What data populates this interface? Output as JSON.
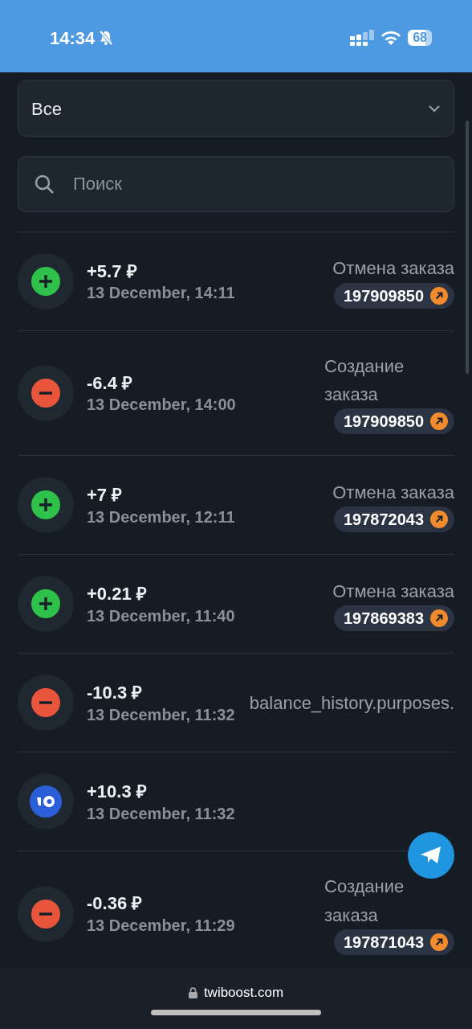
{
  "status_bar": {
    "time": "14:34",
    "battery": "68"
  },
  "filter": {
    "value": "Все"
  },
  "search": {
    "placeholder": "Поиск"
  },
  "transactions": [
    {
      "kind": "plus",
      "amount": "+5.7 ₽",
      "date": "13 December, 14:11",
      "purpose": "Отмена заказа",
      "order": "197909850"
    },
    {
      "kind": "minus",
      "amount": "-6.4 ₽",
      "date": "13 December, 14:00",
      "purpose": "Создание заказа",
      "order": "197909850"
    },
    {
      "kind": "plus",
      "amount": "+7 ₽",
      "date": "13 December, 12:11",
      "purpose": "Отмена заказа",
      "order": "197872043"
    },
    {
      "kind": "plus",
      "amount": "+0.21 ₽",
      "date": "13 December, 11:40",
      "purpose": "Отмена заказа",
      "order": "197869383"
    },
    {
      "kind": "minus",
      "amount": "-10.3 ₽",
      "date": "13 December, 11:32",
      "purpose": "balance_history.purposes."
    },
    {
      "kind": "wallet",
      "amount": "+10.3 ₽",
      "date": "13 December, 11:32"
    },
    {
      "kind": "minus",
      "amount": "-0.36 ₽",
      "date": "13 December, 11:29",
      "purpose": "Создание заказа",
      "order": "197871043"
    }
  ],
  "browser": {
    "url": "twiboost.com"
  }
}
